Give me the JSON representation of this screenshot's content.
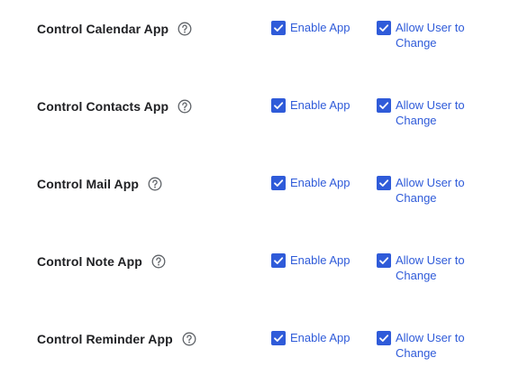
{
  "colors": {
    "accent": "#2f5bd9",
    "label": "#202124",
    "help_icon": "#5f6368"
  },
  "settings": [
    {
      "label": "Control Calendar App",
      "help_icon": "question-circle-icon",
      "enable": {
        "label": "Enable App",
        "checked": true
      },
      "allow": {
        "label": "Allow User to Change",
        "checked": true
      }
    },
    {
      "label": "Control Contacts App",
      "help_icon": "question-circle-icon",
      "enable": {
        "label": "Enable App",
        "checked": true
      },
      "allow": {
        "label": "Allow User to Change",
        "checked": true
      }
    },
    {
      "label": "Control Mail App",
      "help_icon": "question-circle-icon",
      "enable": {
        "label": "Enable App",
        "checked": true
      },
      "allow": {
        "label": "Allow User to Change",
        "checked": true
      }
    },
    {
      "label": "Control Note App",
      "help_icon": "question-circle-icon",
      "enable": {
        "label": "Enable App",
        "checked": true
      },
      "allow": {
        "label": "Allow User to Change",
        "checked": true
      }
    },
    {
      "label": "Control Reminder App",
      "help_icon": "question-circle-icon",
      "enable": {
        "label": "Enable App",
        "checked": true
      },
      "allow": {
        "label": "Allow User to Change",
        "checked": true
      }
    }
  ]
}
